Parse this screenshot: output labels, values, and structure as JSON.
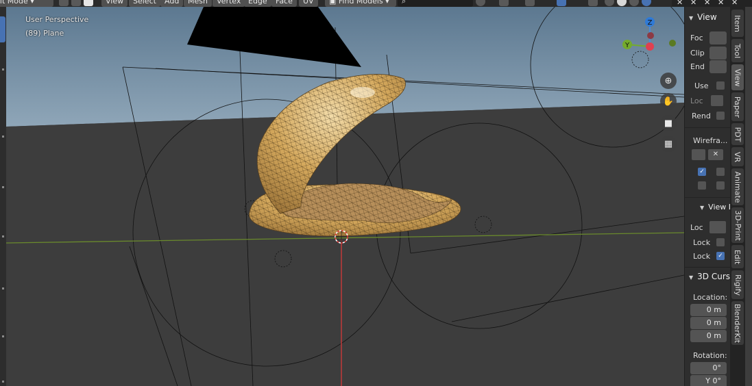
{
  "header": {
    "mode": "Edit Mode",
    "menus": [
      "View",
      "Select",
      "Add",
      "Mesh",
      "Vertex",
      "Edge",
      "Face",
      "UV"
    ],
    "find_models": "Find Models"
  },
  "viewport": {
    "perspective": "User Perspective",
    "object": "(89) Plane",
    "gizmo": {
      "z": "Z",
      "y": "Y"
    }
  },
  "npanel": {
    "view_title": "View",
    "foc": "Foc",
    "clip": "Clip",
    "end": "End",
    "use": "Use",
    "loc1": "Loc",
    "rend": "Rend",
    "wireframe": "Wirefra...",
    "view_lock_title": "View L",
    "loc2": "Loc",
    "lock1": "Lock",
    "lock2": "Lock",
    "cursor_title": "3D Curs",
    "location_label": "Location:",
    "loc_x": "0 m",
    "loc_y": "0 m",
    "loc_z": "0 m",
    "rotation_label": "Rotation:",
    "rot_x": "0°",
    "rot_y": "Y 0°"
  },
  "tabs": [
    "Item",
    "Tool",
    "View",
    "Paper",
    "PDT",
    "VR",
    "Animate",
    "3D-Print",
    "Edit",
    "Rigify",
    "BlenderKit"
  ],
  "colors": {
    "accent": "#4772b3",
    "sky": "#5f7b92",
    "ground": "#3d3d3d",
    "shell": "#c79a4f"
  }
}
